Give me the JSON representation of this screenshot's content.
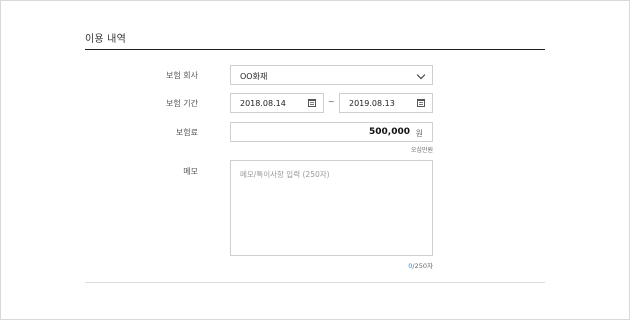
{
  "section": {
    "title": "이용 내역"
  },
  "form": {
    "insurer": {
      "label": "보험 회사",
      "value": "OO화재"
    },
    "period": {
      "label": "보험 기간",
      "start": "2018.08.14",
      "separator": "~",
      "end": "2019.08.13"
    },
    "premium": {
      "label": "보험료",
      "value": "500,000",
      "unit": "원",
      "hint": "오십만원"
    },
    "memo": {
      "label": "메모",
      "placeholder": "메모/특이사항 입력 (250자)",
      "count_current": "0",
      "count_suffix": "/250자"
    }
  },
  "icons": {
    "select": "chevron-down-icon",
    "date": "calendar-icon"
  }
}
